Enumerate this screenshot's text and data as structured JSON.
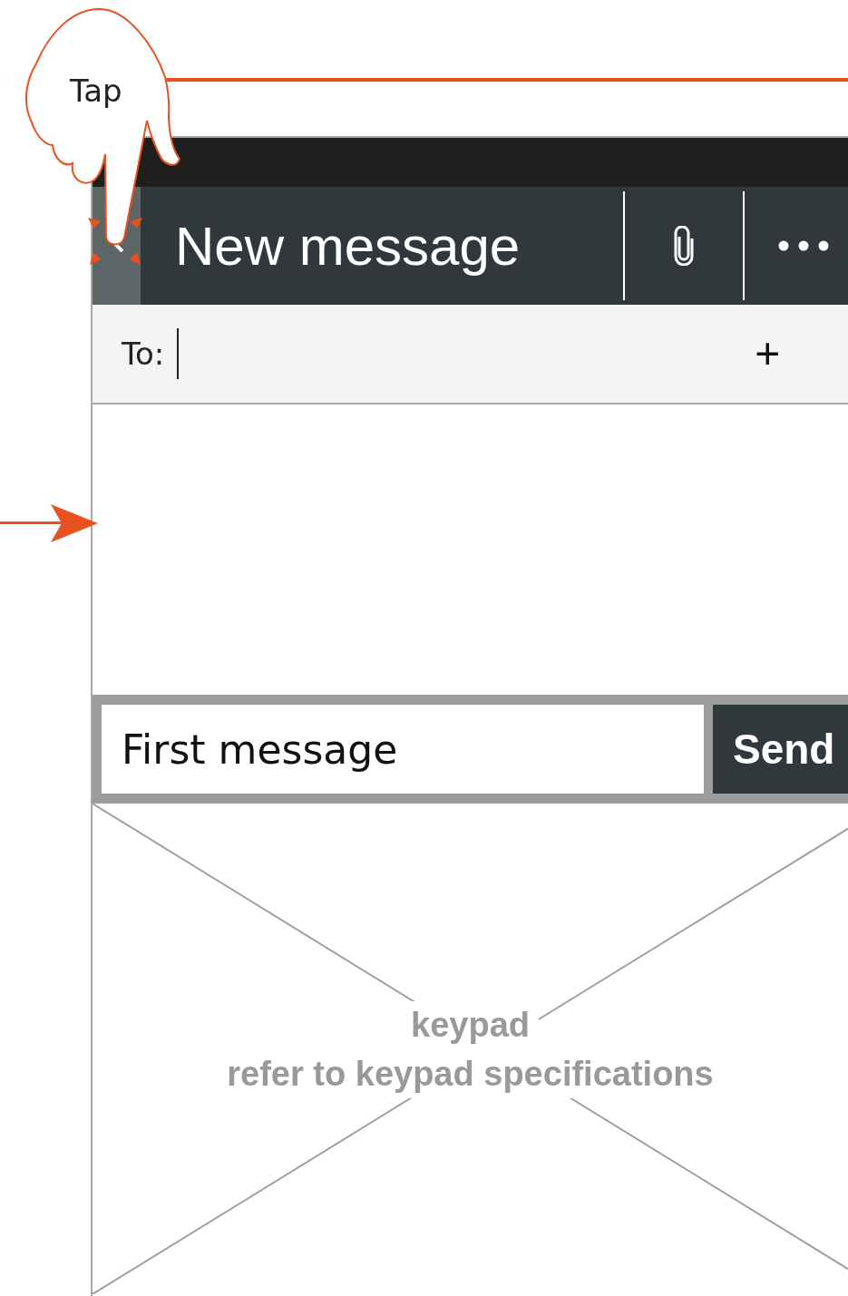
{
  "annotations": {
    "tap_label": "Tap"
  },
  "header": {
    "title": "New message",
    "back_pressed": true
  },
  "to_field": {
    "label": "To:",
    "add": "+"
  },
  "composer": {
    "value": "First message",
    "send": "Send"
  },
  "keypad": {
    "lines": [
      "keypad",
      "refer to keypad specifications"
    ]
  }
}
